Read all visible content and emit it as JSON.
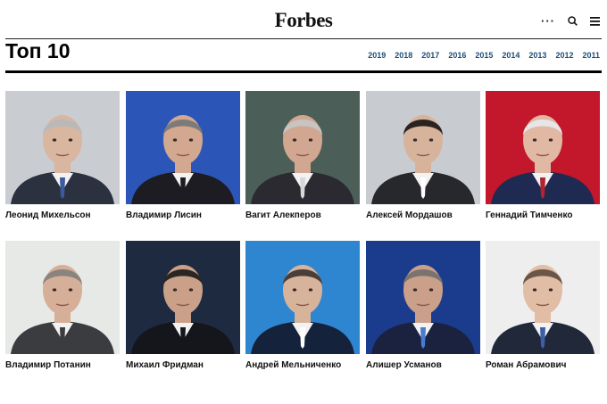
{
  "header": {
    "logo": "Forbes",
    "menu_dots": "···"
  },
  "page": {
    "title": "Топ 10"
  },
  "years": [
    "2019",
    "2018",
    "2017",
    "2016",
    "2015",
    "2014",
    "2013",
    "2012",
    "2011"
  ],
  "people": [
    {
      "name": "Леонид Михельсон",
      "bg": "#c9cdd2",
      "suit": "#2c3140",
      "skin": "#d9b6a0",
      "hair": "#b9b9b9",
      "tie": "#3b5b9e"
    },
    {
      "name": "Владимир Лисин",
      "bg": "#2b56b8",
      "suit": "#1c1c22",
      "skin": "#d3a890",
      "hair": "#7d7a78",
      "tie": "#1c1c22"
    },
    {
      "name": "Вагит Алекперов",
      "bg": "#4b5f58",
      "suit": "#2a2a30",
      "skin": "#d2a791",
      "hair": "#c7c4c1",
      "tie": "#d8d8d8"
    },
    {
      "name": "Алексей Мордашов",
      "bg": "#c8ccd1",
      "suit": "#27282c",
      "skin": "#d8b39c",
      "hair": "#2a2320",
      "tie": "#ffffff"
    },
    {
      "name": "Геннадий Тимченко",
      "bg": "#c3172b",
      "suit": "#1e2a52",
      "skin": "#e0b8a4",
      "hair": "#e6e6e6",
      "tie": "#b2232f"
    },
    {
      "name": "Владимир Потанин",
      "bg": "#e7e9e6",
      "suit": "#3a3c40",
      "skin": "#d6af98",
      "hair": "#8a8480",
      "tie": "#3a3c40"
    },
    {
      "name": "Михаил Фридман",
      "bg": "#1d2a40",
      "suit": "#14161c",
      "skin": "#caa089",
      "hair": "#2a2624",
      "tie": "#14161c"
    },
    {
      "name": "Андрей Мельниченко",
      "bg": "#2f86d0",
      "suit": "#14223c",
      "skin": "#d8b39c",
      "hair": "#4a3f38",
      "tie": "#ffffff"
    },
    {
      "name": "Алишер Усманов",
      "bg": "#1b3c8c",
      "suit": "#1a2240",
      "skin": "#caa08a",
      "hair": "#7a7470",
      "tie": "#4a7bd0"
    },
    {
      "name": "Роман Абрамович",
      "bg": "#eeeeee",
      "suit": "#20283a",
      "skin": "#e2bda6",
      "hair": "#6a5648",
      "tie": "#3d5fa8"
    }
  ]
}
